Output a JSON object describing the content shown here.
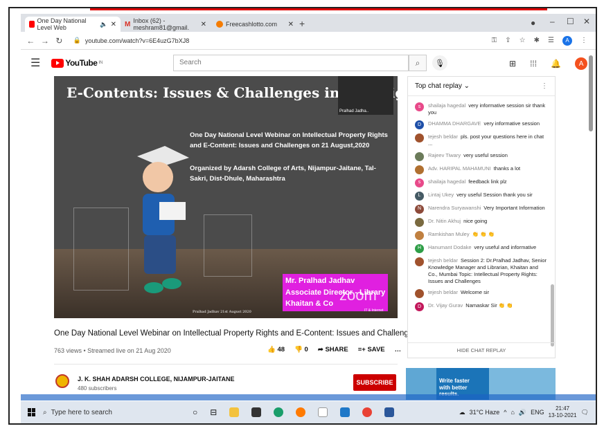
{
  "browser": {
    "tabs": [
      {
        "label": "One Day National Level Web",
        "active": true,
        "color": "#ff0000"
      },
      {
        "label": "Inbox (62) - meshram81@gmail.",
        "active": false,
        "color": "#d93025"
      },
      {
        "label": "Freecashlotto.com",
        "active": false,
        "color": "#f57c00"
      }
    ],
    "url": "youtube.com/watch?v=6E4uzG7bXJ8"
  },
  "youtube": {
    "logo_text": "YouTube",
    "region": "IN",
    "search_placeholder": "Search",
    "avatar_letter": "A"
  },
  "video": {
    "slide_title": "E-Contents: Issues & Challenges in Copyrig",
    "slide_line1": "One Day National Level Webinar on Intellectual Property Rights and E-Content: Issues and Challenges on 21 August,2020",
    "slide_line2": "Organized by Adarsh College of Arts, Nijampur-Jaitane, Tal-Sakri, Dist-Dhule, Maharashtra",
    "camera_name": "Pralhad Jadha..",
    "speaker_line1": "Mr. Pralhad Jadhav",
    "speaker_line2": "Associate Director - Library",
    "speaker_line3": "Khaitan & Co",
    "watermark": "zoom",
    "footer_left": "Pralhad Jadhav 21st August 2020",
    "footer_right": "IT & Internet",
    "title": "One Day National Level Webinar on Intellectual Property Rights and E-Content: Issues and Challenges",
    "meta": "763 views • Streamed live on 21 Aug 2020",
    "likes": "48",
    "dislikes": "0",
    "share_label": "SHARE",
    "save_label": "SAVE"
  },
  "channel": {
    "name": "J. K. SHAH ADARSH COLLEGE, NIJAMPUR-JAITANE",
    "subscribers": "480 subscribers",
    "subscribe_label": "SUBSCRIBE"
  },
  "chat": {
    "header": "Top chat replay",
    "hide_label": "HIDE CHAT REPLAY",
    "messages": [
      {
        "author": "shailaja hagedal",
        "text": "very informative session sir thank you",
        "color": "#e84a8a",
        "initial": "s"
      },
      {
        "author": "DHAMMA DHARGAVE",
        "text": "very informative session",
        "color": "#1e4fa8",
        "initial": "D"
      },
      {
        "author": "tejesh beldar",
        "text": "pls. post your questions here in chat ...",
        "color": "#a0522d",
        "initial": ""
      },
      {
        "author": "Rajeev Tiwary",
        "text": "very useful session",
        "color": "#6b7b5a",
        "initial": ""
      },
      {
        "author": "Adv. HARIPAL MAHAMUNI",
        "text": "thanks a lot",
        "color": "#b07030",
        "initial": ""
      },
      {
        "author": "shailaja hagedal",
        "text": "feedback link plz",
        "color": "#e84a8a",
        "initial": "s"
      },
      {
        "author": "Lintaj Ukey",
        "text": "very useful Session thank you sir",
        "color": "#455a64",
        "initial": "L"
      },
      {
        "author": "Narendra Suryawanshi",
        "text": "Very Important Information",
        "color": "#8d4a3a",
        "initial": "N"
      },
      {
        "author": "Dr. Nitin Akhuj",
        "text": "nice going",
        "color": "#7a6a40",
        "initial": ""
      },
      {
        "author": "Ramkishan Muley",
        "text": "👏 👏 👏",
        "color": "#c08040",
        "initial": ""
      },
      {
        "author": "Hanumant Dodake",
        "text": "very useful and informative",
        "color": "#2e9e47",
        "initial": "H"
      },
      {
        "author": "tejesh beldar",
        "text": "Session 2: Dr.Pralhad Jadhav, Senior Knowledge Manager and Librarian, Khaitan and Co., Mumbai Topic: Intellectual Property Rights: Issues and Challenges",
        "color": "#a0522d",
        "initial": ""
      },
      {
        "author": "tejesh beldar",
        "text": "Welcome sir",
        "color": "#a0522d",
        "initial": ""
      },
      {
        "author": "Dr. Vijay Gurav",
        "text": "Namaskar Sir 👏 👏",
        "color": "#c2185b",
        "initial": "D"
      }
    ]
  },
  "ad": {
    "text": "Write faster with better results."
  },
  "taskbar": {
    "search_placeholder": "Type here to search",
    "weather": "31°C Haze",
    "lang": "ENG",
    "time": "21:47",
    "date": "13-10-2021"
  }
}
